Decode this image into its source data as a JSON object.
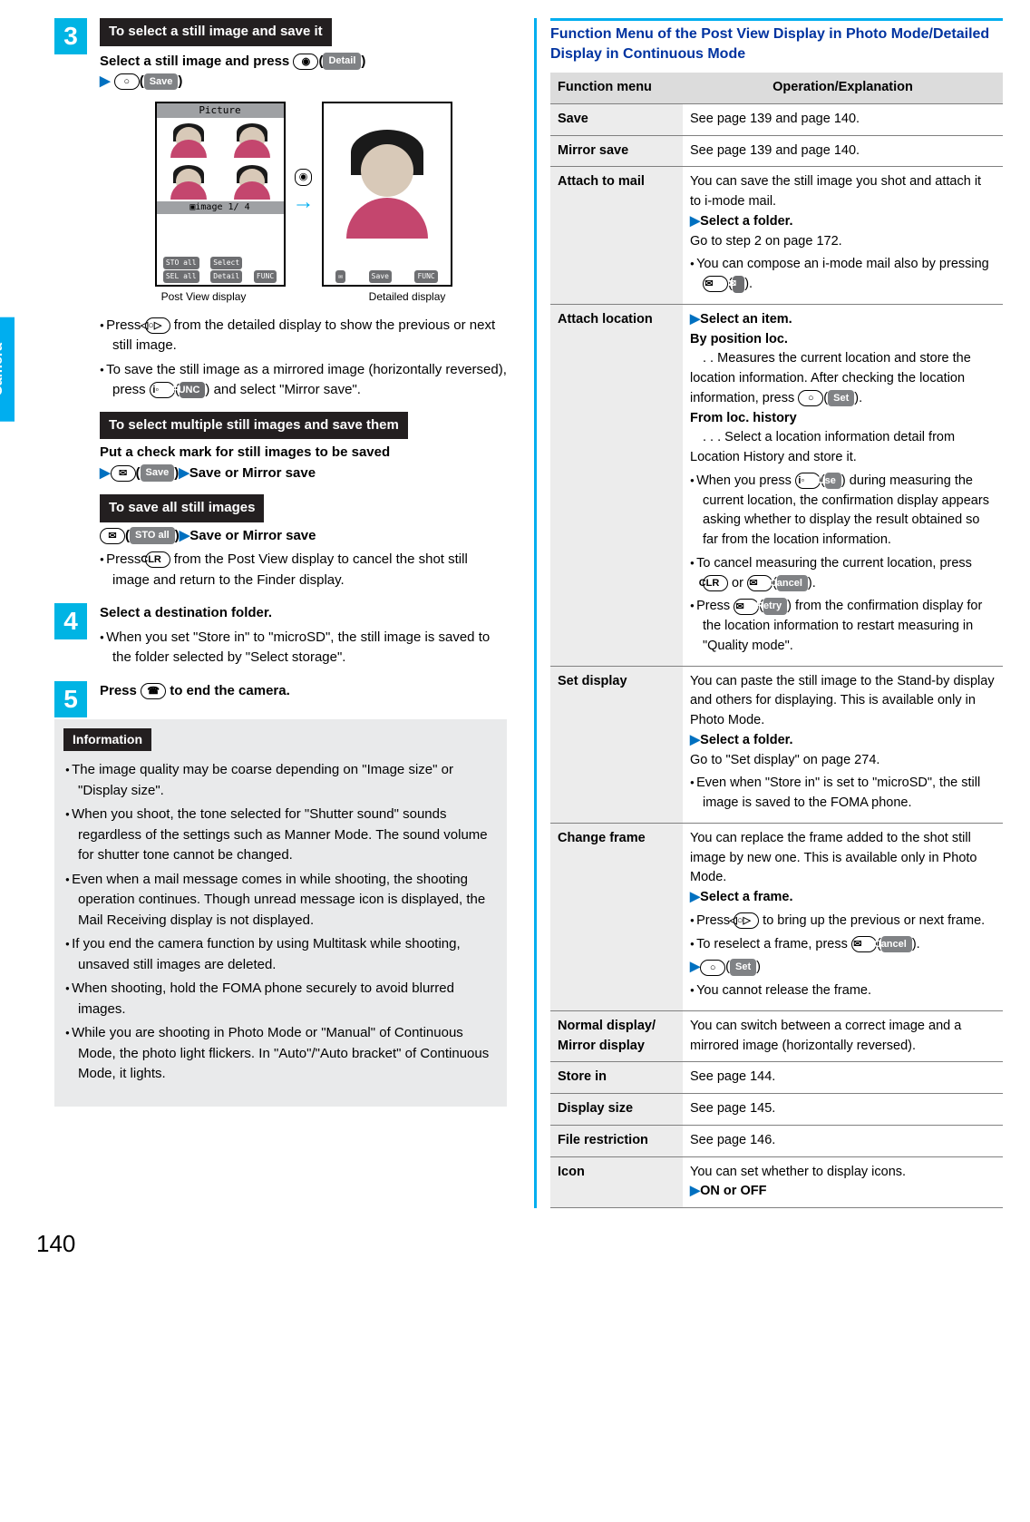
{
  "sideTab": "Camera",
  "pageNumber": "140",
  "step3": {
    "num": "3",
    "bar": "To select a still image and save it",
    "instr_a": "Select a still image and press ",
    "detail": "Detail",
    "save": "Save",
    "screenA_title": "Picture",
    "screenA_mid": "▣image 1/ 4",
    "sk_sto": "STO all",
    "sk_sel": "SEL all",
    "sk_select": "Select",
    "sk_detail": "Detail",
    "sk_func": "FUNC",
    "sk_save": "Save",
    "capA": "Post View display",
    "capB": "Detailed display",
    "bul1a": "Press ",
    "bul1b": " from the detailed display to show the previous or next still image.",
    "bul2a": "To save the still image as a mirrored image (horizontally reversed), press ",
    "bul2b": ") and select \"Mirror save\".",
    "func": "FUNC",
    "bar2": "To select multiple still images and save them",
    "multi_a": "Put a check mark for still images to be saved",
    "multi_b": "Save or Mirror save",
    "bar3": "To save all still images",
    "stoall": "STO all",
    "all_b": "Save or Mirror save",
    "bul3a": "Press ",
    "clr": "CLR",
    "bul3b": " from the Post View display to cancel the shot still image and return to the Finder display."
  },
  "step4": {
    "num": "4",
    "title": "Select a destination folder.",
    "bul": "When you set \"Store in\" to \"microSD\", the still image is saved to the folder selected by \"Select storage\"."
  },
  "step5": {
    "num": "5",
    "title_a": "Press ",
    "title_b": " to end the camera."
  },
  "info": {
    "label": "Information",
    "items": [
      "The image quality may be coarse depending on \"Image size\" or \"Display size\".",
      "When you shoot, the tone selected for \"Shutter sound\" sounds regardless of the settings such as Manner Mode. The sound volume for shutter tone cannot be changed.",
      "Even when a mail message comes in while shooting, the shooting operation continues. Though unread message icon is displayed, the Mail Receiving display is not displayed.",
      "If you end the camera function by using Multitask while shooting, unsaved still images are deleted.",
      "When shooting, hold the FOMA phone securely to avoid blurred images.",
      "While you are shooting in Photo Mode or \"Manual\" of Continuous Mode, the photo light flickers. In \"Auto\"/\"Auto bracket\" of Continuous Mode, it lights."
    ]
  },
  "menuTitle": "Function Menu of the Post View Display in Photo Mode/Detailed Display in Continuous Mode",
  "th1": "Function menu",
  "th2": "Operation/Explanation",
  "rows": {
    "save": {
      "k": "Save",
      "v": "See page 139 and page 140."
    },
    "mirror": {
      "k": "Mirror save",
      "v": "See page 139 and page 140."
    },
    "attach": {
      "k": "Attach to mail",
      "l1": "You can save the still image you shot and attach it to i-mode mail.",
      "l2": "Select a folder.",
      "l3": "Go to step 2 on page 172.",
      "l4a": "You can compose an i-mode mail also by pressing ",
      "l4b": ")."
    },
    "loc": {
      "k": "Attach location",
      "l1": "Select an item.",
      "l2": "By position loc.",
      "l3": ". .  Measures the current location and store the location information. After checking the location information, press ",
      "set": "Set",
      "l4": "From loc. history",
      "l5": ". . . Select a location information detail from Location History and store it.",
      "l6a": "When you press ",
      "use": "Use",
      "l6b": ") during measuring the current location, the confirmation display appears asking whether to display the result obtained so far from the location information.",
      "l7a": "To cancel measuring the current location, press ",
      "clr": "CLR",
      "l7b": " or ",
      "cancel": "Cancel",
      "l7c": ").",
      "l8a": "Press ",
      "retry": "Retry",
      "l8b": ") from the confirmation display for the location information to restart measuring in \"Quality mode\"."
    },
    "setdisp": {
      "k": "Set display",
      "l1": "You can paste the still image to the Stand-by display and others for displaying. This is available only in Photo Mode.",
      "l2": "Select a folder.",
      "l3": "Go to \"Set display\" on page 274.",
      "l4": "Even when \"Store in\" is set to \"microSD\", the still image is saved to the FOMA phone."
    },
    "frame": {
      "k": "Change frame",
      "l1": "You can replace the frame added to the shot still image by new one. This is available only in Photo Mode.",
      "l2": "Select a frame.",
      "l3a": "Press ",
      "l3b": " to bring up the previous or next frame.",
      "l4a": "To reselect a frame, press ",
      "cancel": "Cancel",
      "l4b": ").",
      "set": "Set",
      "l5": "You cannot release the frame."
    },
    "normal": {
      "k": "Normal display/ Mirror display",
      "v": "You can switch between a correct image and a mirrored image (horizontally reversed)."
    },
    "store": {
      "k": "Store in",
      "v": "See page 144."
    },
    "dsize": {
      "k": "Display size",
      "v": "See page 145."
    },
    "frest": {
      "k": "File restriction",
      "v": "See page 146."
    },
    "icon": {
      "k": "Icon",
      "l1": "You can set whether to display icons.",
      "l2": "ON or OFF"
    }
  }
}
